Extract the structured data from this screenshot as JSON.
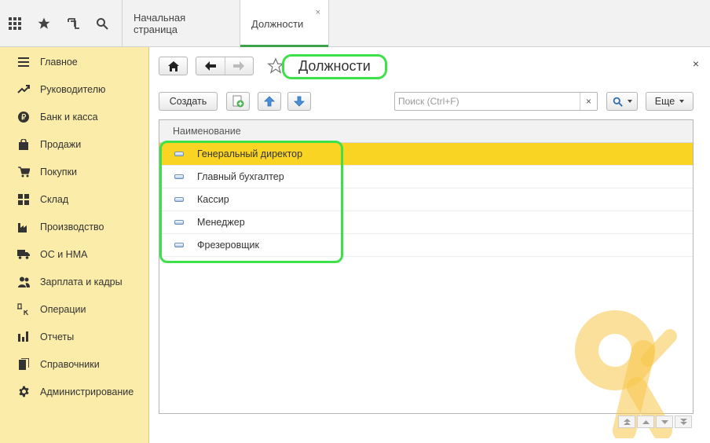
{
  "topbar": {
    "icons": [
      "apps-grid-icon",
      "star-icon",
      "history-icon",
      "search-icon"
    ],
    "tabs": [
      {
        "label": "Начальная страница",
        "active": false
      },
      {
        "label": "Должности",
        "active": true,
        "close": "×"
      }
    ]
  },
  "sidebar": {
    "items": [
      {
        "label": "Главное",
        "icon": "menu-icon"
      },
      {
        "label": "Руководителю",
        "icon": "trend-icon"
      },
      {
        "label": "Банк и касса",
        "icon": "ruble-icon"
      },
      {
        "label": "Продажи",
        "icon": "bag-icon"
      },
      {
        "label": "Покупки",
        "icon": "cart-icon"
      },
      {
        "label": "Склад",
        "icon": "warehouse-icon"
      },
      {
        "label": "Производство",
        "icon": "factory-icon"
      },
      {
        "label": "ОС и НМА",
        "icon": "truck-icon"
      },
      {
        "label": "Зарплата и кадры",
        "icon": "people-icon"
      },
      {
        "label": "Операции",
        "icon": "dt-kt-icon"
      },
      {
        "label": "Отчеты",
        "icon": "bar-chart-icon"
      },
      {
        "label": "Справочники",
        "icon": "books-icon"
      },
      {
        "label": "Администрирование",
        "icon": "gear-icon"
      }
    ]
  },
  "form": {
    "title": "Должности",
    "close": "×",
    "toolbar": {
      "create_label": "Создать",
      "more_label": "Еще",
      "search_placeholder": "Поиск (Ctrl+F)",
      "search_clear": "×"
    },
    "table": {
      "column_header": "Наименование",
      "rows": [
        "Генеральный директор",
        "Главный бухгалтер",
        "Кассир",
        "Менеджер",
        "Фрезеровщик"
      ],
      "selected_index": 0
    }
  },
  "colors": {
    "sidebar_bg": "#fbeda9",
    "selected_row": "#f9d422",
    "highlight_green": "#3ee04a",
    "active_tab_underline": "#3ca34c",
    "watermark": "#f7c64a"
  }
}
